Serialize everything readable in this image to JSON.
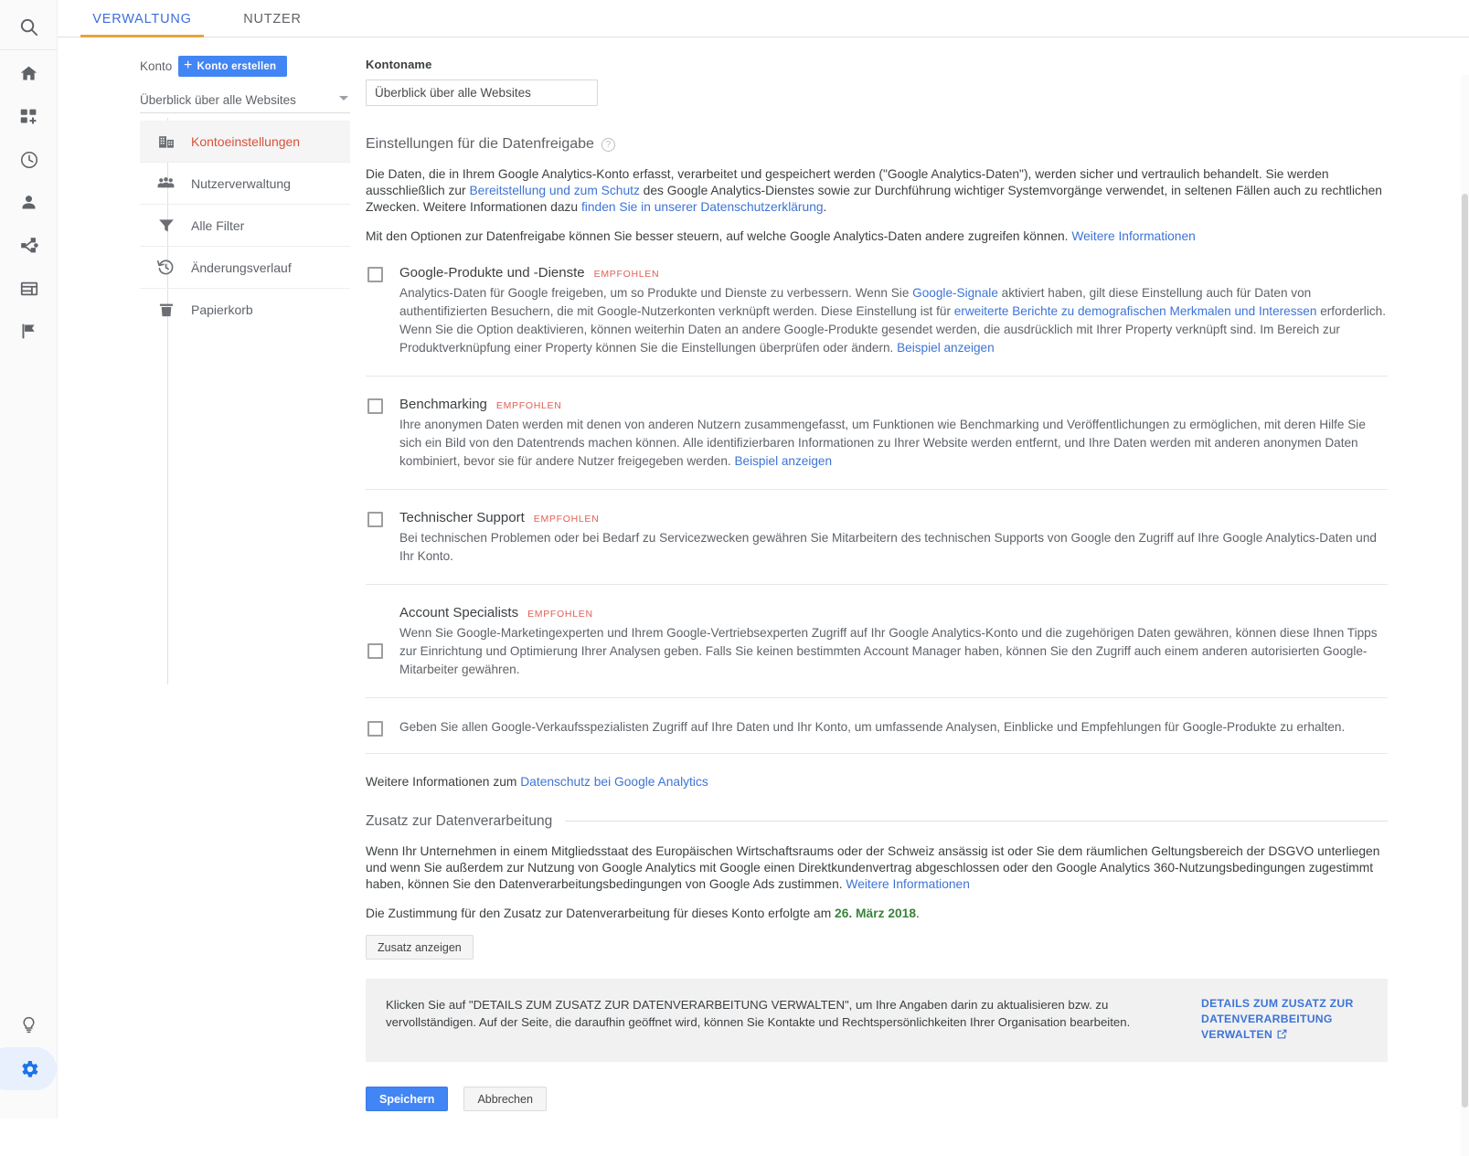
{
  "rail": {
    "icons": [
      {
        "name": "search-icon",
        "label": "Suche"
      },
      {
        "name": "home-icon",
        "label": "Startseite"
      },
      {
        "name": "customization-icon",
        "label": "Anpassung"
      },
      {
        "name": "realtime-clock-icon",
        "label": "Echtzeit"
      },
      {
        "name": "audience-person-icon",
        "label": "Zielgruppe"
      },
      {
        "name": "acquisition-share-icon",
        "label": "Akquisition"
      },
      {
        "name": "behavior-window-icon",
        "label": "Verhalten"
      },
      {
        "name": "conversions-flag-icon",
        "label": "Conversions"
      },
      {
        "name": "discover-bulb-icon",
        "label": "Entdecken"
      },
      {
        "name": "admin-gear-icon",
        "label": "Verwaltung"
      }
    ],
    "active_icon": "admin-gear-icon",
    "active_color": "#1a73e8",
    "active_pill_color": "#e8f0fe"
  },
  "tabs": {
    "items": [
      {
        "label": "VERWALTUNG",
        "active": true
      },
      {
        "label": "NUTZER",
        "active": false
      }
    ],
    "active_underline_color": "#e8a33d",
    "active_text_color": "#3c6ddd"
  },
  "admin_nav": {
    "konto_label": "Konto",
    "create_account_button": "Konto erstellen",
    "account_select_value": "Überblick über alle Websites",
    "collapse_button_icon": "arrow-left-icon",
    "items": [
      {
        "label": "Kontoeinstellungen",
        "icon": "building-icon",
        "selected": true
      },
      {
        "label": "Nutzerverwaltung",
        "icon": "people-icon",
        "selected": false
      },
      {
        "label": "Alle Filter",
        "icon": "funnel-icon",
        "selected": false
      },
      {
        "label": "Änderungsverlauf",
        "icon": "history-icon",
        "selected": false
      },
      {
        "label": "Papierkorb",
        "icon": "trash-icon",
        "selected": false
      }
    ],
    "selected_color": "#d9513b"
  },
  "main": {
    "account_name_label": "Kontoname",
    "account_name_value": "Überblick über alle Websites",
    "account_name_placeholder": "Kontoname",
    "data_sharing": {
      "title": "Einstellungen für die Datenfreigabe",
      "help_icon": "help-circle-icon",
      "intro_1_a": "Die Daten, die in Ihrem Google Analytics-Konto erfasst, verarbeitet und gespeichert werden (\"Google Analytics-Daten\"), werden sicher und vertraulich behandelt. Sie werden ausschließlich zur ",
      "intro_1_link_1": "Bereitstellung und zum Schutz",
      "intro_1_b": " des Google Analytics-Dienstes sowie zur Durchführung wichtiger Systemvorgänge verwendet, in seltenen Fällen auch zu rechtlichen Zwecken. Weitere Informationen dazu ",
      "intro_1_link_2": "finden Sie in unserer Datenschutzerklärung",
      "intro_1_c": ".",
      "intro_2_a": "Mit den Optionen zur Datenfreigabe können Sie besser steuern, auf welche Google Analytics-Daten andere zugreifen können. ",
      "intro_2_link": "Weitere Informationen",
      "recommended_badge": "EMPFOHLEN",
      "options": [
        {
          "title": "Google-Produkte und -Dienste",
          "recommended": true,
          "checked": false,
          "desc_a": "Analytics-Daten für Google freigeben, um so Produkte und Dienste zu verbessern. Wenn Sie ",
          "link_1": "Google-Signale",
          "desc_b": " aktiviert haben, gilt diese Einstellung auch für Daten von authentifizierten Besuchern, die mit Google-Nutzerkonten verknüpft werden. Diese Einstellung ist für ",
          "link_2": "erweiterte Berichte zu demografischen Merkmalen und Interessen",
          "desc_c": " erforderlich. Wenn Sie die Option deaktivieren, können weiterhin Daten an andere Google-Produkte gesendet werden, die ausdrücklich mit Ihrer Property verknüpft sind. Im Bereich zur Produktverknüpfung einer Property können Sie die Einstellungen überprüfen oder ändern. ",
          "link_3": "Beispiel anzeigen"
        },
        {
          "title": "Benchmarking",
          "recommended": true,
          "checked": false,
          "desc_a": "Ihre anonymen Daten werden mit denen von anderen Nutzern zusammengefasst, um Funktionen wie Benchmarking und Veröffentlichungen zu ermöglichen, mit deren Hilfe Sie sich ein Bild von den Datentrends machen können. Alle identifizierbaren Informationen zu Ihrer Website werden entfernt, und Ihre Daten werden mit anderen anonymen Daten kombiniert, bevor sie für andere Nutzer freigegeben werden. ",
          "link_1": "Beispiel anzeigen"
        },
        {
          "title": "Technischer Support",
          "recommended": true,
          "checked": false,
          "desc_a": "Bei technischen Problemen oder bei Bedarf zu Servicezwecken gewähren Sie Mitarbeitern des technischen Supports von Google den Zugriff auf Ihre Google Analytics-Daten und Ihr Konto."
        },
        {
          "title": "Account Specialists",
          "recommended": true,
          "checked": false,
          "desc_a": "Wenn Sie Google-Marketingexperten und Ihrem Google-Vertriebsexperten Zugriff auf Ihr Google Analytics-Konto und die zugehörigen Daten gewähren, können diese Ihnen Tipps zur Einrichtung und Optimierung Ihrer Analysen geben. Falls Sie keinen bestimmten Account Manager haben, können Sie den Zugriff auch einem anderen autorisierten Google-Mitarbeiter gewähren."
        },
        {
          "title": "",
          "recommended": false,
          "checked": false,
          "desc_a": "Geben Sie allen Google-Verkaufsspezialisten Zugriff auf Ihre Daten und Ihr Konto, um umfassende Analysen, Einblicke und Empfehlungen für Google-Produkte zu erhalten."
        }
      ],
      "more_info_a": "Weitere Informationen zum ",
      "more_info_link": "Datenschutz bei Google Analytics"
    },
    "dpa": {
      "title": "Zusatz zur Datenverarbeitung",
      "paragraph_a": "Wenn Ihr Unternehmen in einem Mitgliedsstaat des Europäischen Wirtschaftsraums oder der Schweiz ansässig ist oder Sie dem räumlichen Geltungsbereich der DSGVO unterliegen und wenn Sie außerdem zur Nutzung von Google Analytics mit Google einen Direktkundenvertrag abgeschlossen oder den Google Analytics 360-Nutzungsbedingungen zugestimmt haben, können Sie den Datenverarbeitungsbedingungen von Google Ads zustimmen. ",
      "paragraph_link": "Weitere Informationen",
      "consent_prefix": "Die Zustimmung für den Zusatz zur Datenverarbeitung für dieses Konto erfolgte am ",
      "consent_date": "26. März 2018",
      "consent_suffix": ".",
      "show_addendum_button": "Zusatz anzeigen",
      "notice_text": "Klicken Sie auf \"DETAILS ZUM ZUSATZ ZUR DATENVERARBEITUNG VERWALTEN\", um Ihre Angaben darin zu aktualisieren bzw. zu vervollständigen. Auf der Seite, die daraufhin geöffnet wird, können Sie Kontakte und Rechtspersönlichkeiten Ihrer Organisation bearbeiten.",
      "notice_link": "DETAILS ZUM ZUSATZ ZUR DATENVERARBEITUNG VERWALTEN",
      "notice_link_icon": "external-link-icon",
      "date_color": "#3a833a"
    },
    "actions": {
      "save_label": "Speichern",
      "cancel_label": "Abbrechen",
      "save_color": "#4285f4"
    }
  }
}
